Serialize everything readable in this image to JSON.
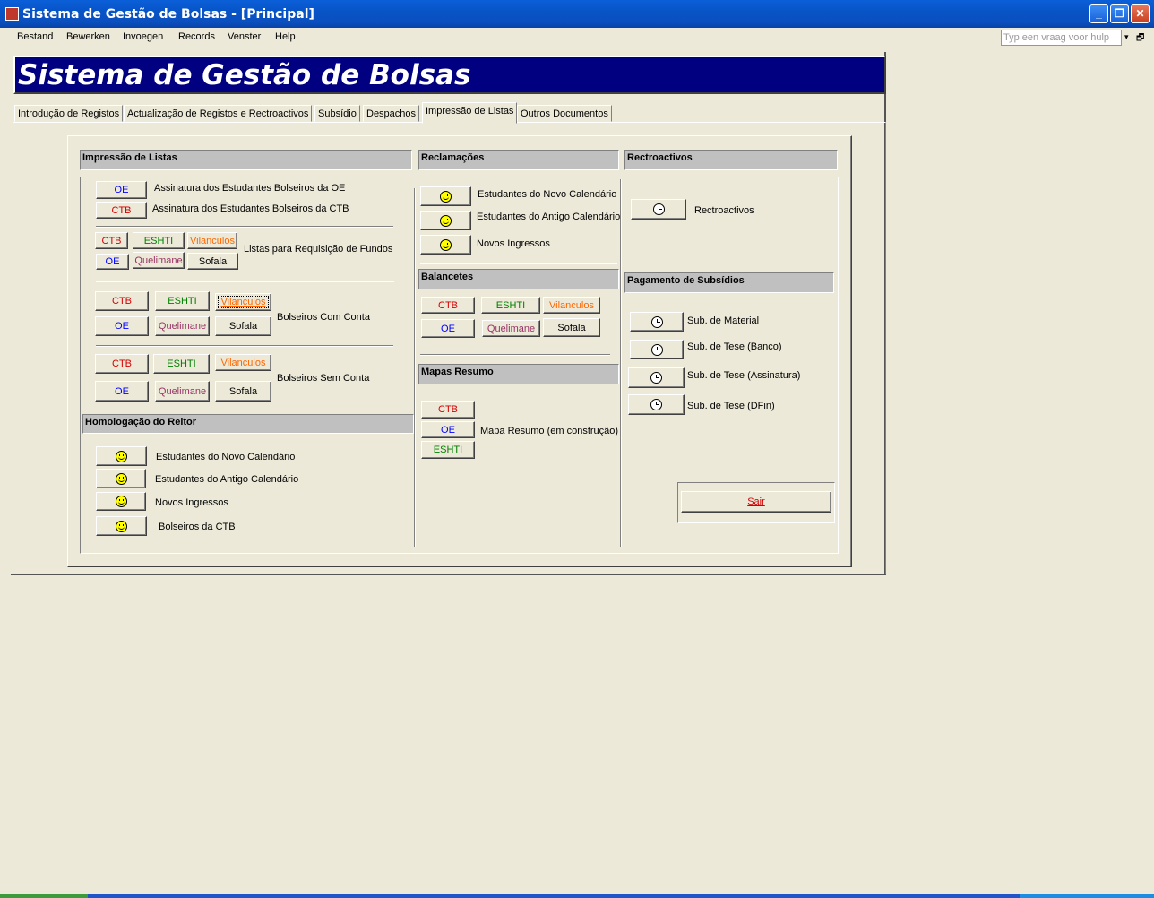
{
  "window": {
    "title": "Sistema de Gestão de Bolsas - [Principal]",
    "app_icon": "access-form-icon",
    "minimize_glyph": "_",
    "restore_glyph": "❐",
    "close_glyph": "✕"
  },
  "menu": {
    "items": [
      "Bestand",
      "Bewerken",
      "Invoegen",
      "Records",
      "Venster",
      "Help"
    ],
    "help_placeholder": "Typ een vraag voor hulp",
    "dropdown_glyph": "▾",
    "restore_glyph": "🗗"
  },
  "banner": {
    "title": "Sistema de Gestão de Bolsas"
  },
  "tabs": [
    {
      "label": "Introdução de Registos",
      "active": false
    },
    {
      "label": "Actualização de Registos e  Rectroactivos",
      "active": false
    },
    {
      "label": "Subsídio",
      "active": false
    },
    {
      "label": "Despachos",
      "active": false
    },
    {
      "label": "Impressão de Listas",
      "active": true
    },
    {
      "label": "Outros Documentos",
      "active": false
    }
  ],
  "sections": {
    "impressao": {
      "header": "Impressão de Listas",
      "assinatura_oe": {
        "button": "OE",
        "label": "Assinatura dos Estudantes Bolseiros da OE"
      },
      "assinatura_ctb": {
        "button": "CTB",
        "label": "Assinatura dos Estudantes Bolseiros da CTB"
      },
      "requisicao": {
        "label": "Listas para Requisição de Fundos",
        "buttons": [
          "CTB",
          "ESHTI",
          "Vilanculos",
          "OE",
          "Quelimane",
          "Sofala"
        ]
      },
      "com_conta": {
        "label": "Bolseiros Com Conta",
        "buttons": [
          "CTB",
          "ESHTI",
          "Vilanculos",
          "OE",
          "Quelimane",
          "Sofala"
        ]
      },
      "sem_conta": {
        "label": "Bolseiros Sem Conta",
        "buttons": [
          "CTB",
          "ESHTI",
          "Vilanculos",
          "OE",
          "Quelimane",
          "Sofala"
        ]
      }
    },
    "homologacao": {
      "header": "Homologação do Reitor",
      "items": [
        "Estudantes do Novo Calendário",
        "Estudantes do Antigo Calendário",
        "Novos Ingressos",
        "Bolseiros da CTB"
      ]
    },
    "reclamacoes": {
      "header": "Reclamações",
      "items": [
        "Estudantes do Novo Calendário",
        "Estudantes do Antigo Calendário",
        "Novos Ingressos"
      ]
    },
    "balancetes": {
      "header": "Balancetes",
      "buttons": [
        "CTB",
        "ESHTI",
        "Vilanculos",
        "OE",
        "Quelimane",
        "Sofala"
      ]
    },
    "mapas": {
      "header": "Mapas Resumo",
      "buttons": [
        "CTB",
        "OE",
        "ESHTI"
      ],
      "label": "Mapa Resumo (em construção)"
    },
    "rectroactivos": {
      "header": "Rectroactivos",
      "label": "Rectroactivos"
    },
    "pagamento": {
      "header": "Pagamento de Subsídios",
      "items": [
        "Sub. de Material",
        "Sub. de Tese (Banco)",
        "Sub. de Tese (Assinatura)",
        "Sub. de Tese (DFin)"
      ]
    }
  },
  "sair": "Sair",
  "colors": {
    "banner_bg": "#000080",
    "titlebar": "#0a5fd8",
    "face": "#ece9d8",
    "ctb": "#d40000",
    "eshti": "#008000",
    "vilanculos": "#ff6600",
    "oe": "#0000ff",
    "quelimane": "#993366"
  }
}
